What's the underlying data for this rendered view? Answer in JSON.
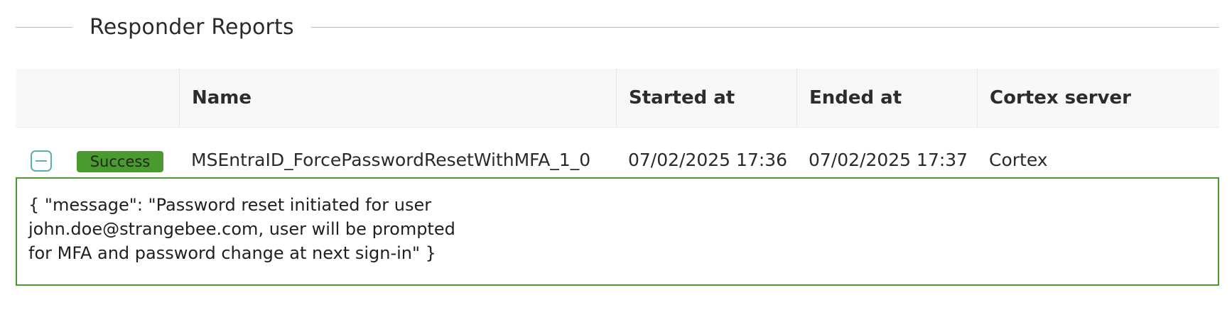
{
  "section": {
    "title": "Responder Reports"
  },
  "table": {
    "columns": [
      "Name",
      "Started at",
      "Ended at",
      "Cortex server"
    ],
    "rows": [
      {
        "status": "Success",
        "name": "MSEntraID_ForcePasswordResetWithMFA_1_0",
        "started_at": "07/02/2025 17:36",
        "ended_at": "07/02/2025 17:37",
        "cortex_server": "Cortex",
        "expanded": true,
        "report": "{ \"message\": \"Password reset initiated for user\njohn.doe@strangebee.com, user will be prompted\nfor MFA and password change at next sign-in\" }"
      }
    ]
  },
  "colors": {
    "success": "#4a9a2f",
    "toggle_accent": "#5bb0ae",
    "header_bg": "#f8f8f8"
  },
  "icons": {
    "collapse": "minus-square-icon"
  }
}
